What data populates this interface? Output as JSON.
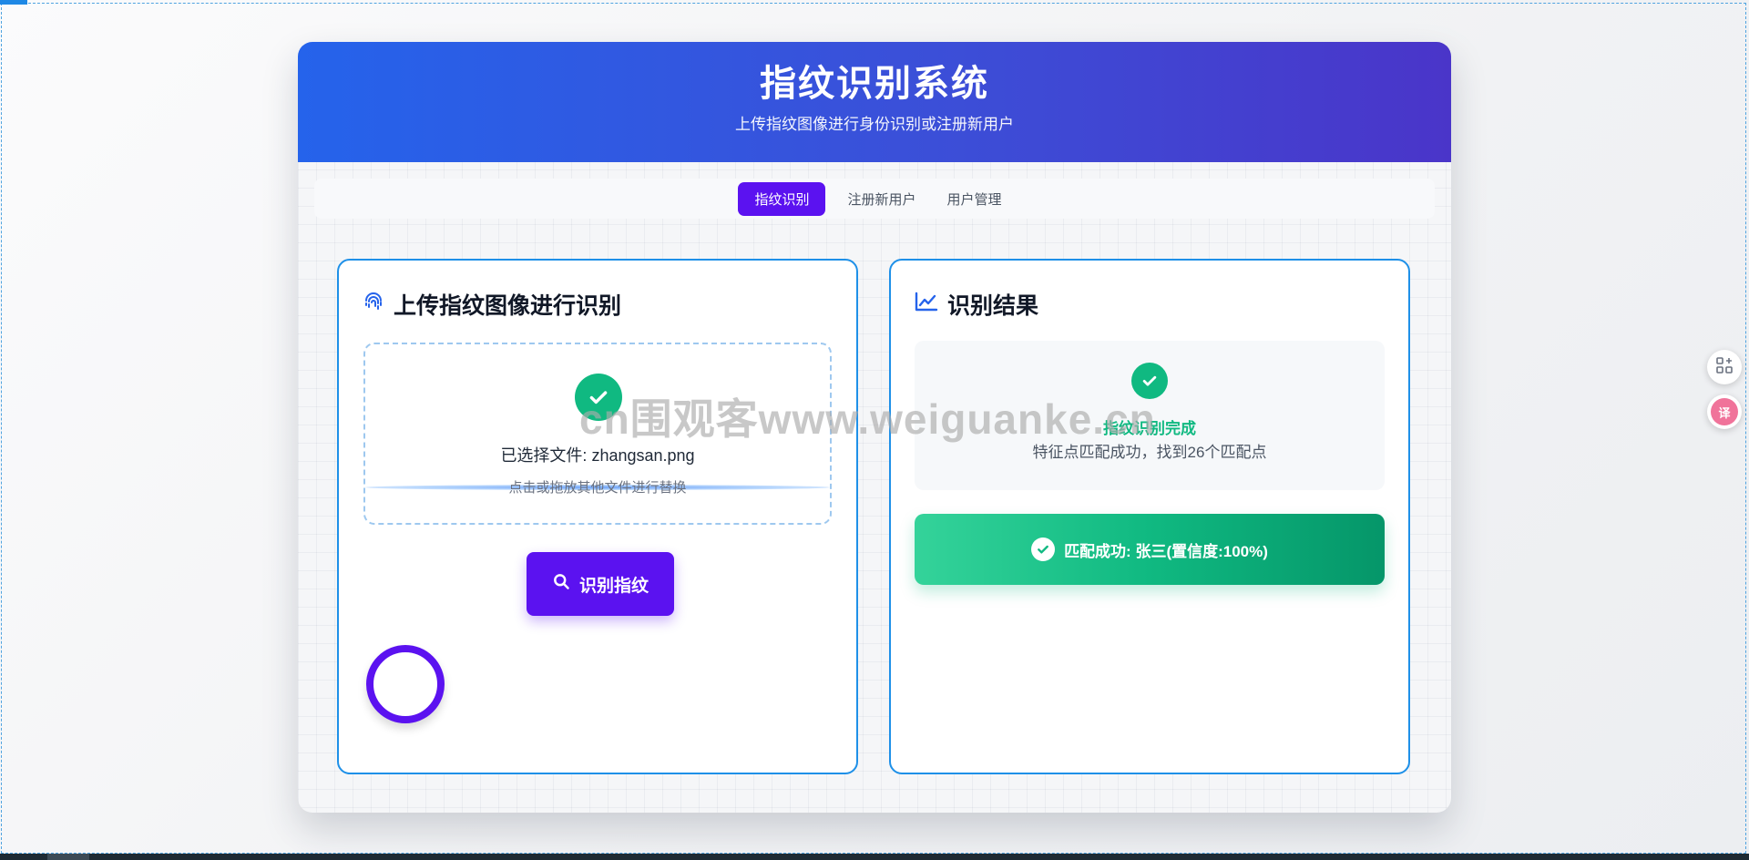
{
  "header": {
    "title": "指纹识别系统",
    "subtitle": "上传指纹图像进行身份识别或注册新用户"
  },
  "tabs": [
    {
      "label": "指纹识别",
      "active": true
    },
    {
      "label": "注册新用户",
      "active": false
    },
    {
      "label": "用户管理",
      "active": false
    }
  ],
  "upload_card": {
    "title": "上传指纹图像进行识别",
    "icon": "fingerprint-icon",
    "selected_file": "已选择文件: zhangsan.png",
    "hint": "点击或拖放其他文件进行替换",
    "button_label": "识别指纹",
    "button_icon": "search-icon"
  },
  "result_card": {
    "title": "识别结果",
    "icon": "chart-line-icon",
    "status_title": "指纹识别完成",
    "status_detail": "特征点匹配成功，找到26个匹配点",
    "match_text": "匹配成功: 张三(置信度:100%)"
  },
  "watermark": "cn围观客www.weiguanke.cn",
  "colors": {
    "primary": "#5b12f0",
    "header_start": "#2563eb",
    "header_end": "#4a35c9",
    "success": "#10b981",
    "card_border": "#1e90e8"
  }
}
